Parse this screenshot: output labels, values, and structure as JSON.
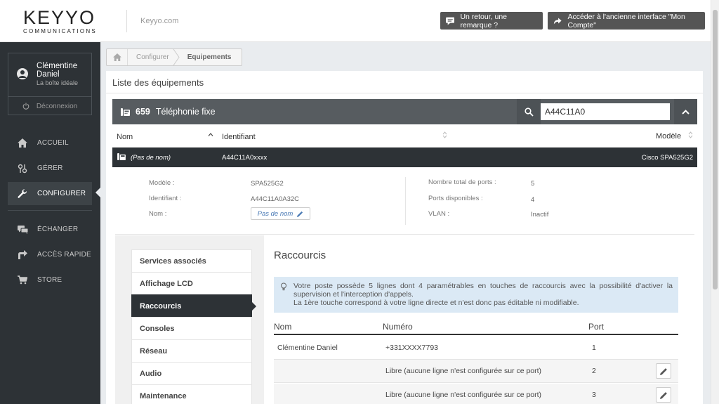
{
  "header": {
    "logo_word": "KEYYO",
    "logo_sub": "COMMUNICATIONS",
    "site_link": "Keyyo.com",
    "feedback_button": "Un retour, une remarque ?",
    "old_interface_button": "Accéder à l'ancienne interface \"Mon Compte\""
  },
  "user": {
    "name": "Clémentine Daniel",
    "company": "La boîte idéale",
    "logout": "Déconnexion"
  },
  "nav": {
    "home": "ACCUEIL",
    "manage": "GÉRER",
    "configure": "CONFIGURER",
    "exchange": "ÉCHANGER",
    "quick_access": "ACCÈS RAPIDE",
    "store": "STORE"
  },
  "breadcrumb": {
    "configure": "Configurer",
    "equipment": "Equipements"
  },
  "panel": {
    "title": "Liste des équipements",
    "count": "659",
    "category": "Téléphonie fixe",
    "search_value": "A44C11A0"
  },
  "columns": {
    "name": "Nom",
    "identifier": "Identifiant",
    "model": "Modèle"
  },
  "selected_row": {
    "name": "(Pas de nom)",
    "identifier": "A44C11A0xxxx",
    "model": "Cisco SPA525G2"
  },
  "details": {
    "model_label": "Modèle :",
    "model_value": "SPA525G2",
    "identifier_label": "Identifiant :",
    "identifier_value": "A44C11A0A32C",
    "name_label": "Nom :",
    "name_value": "Pas de nom",
    "total_ports_label": "Nombre total de ports :",
    "total_ports_value": "5",
    "available_ports_label": "Ports disponibles :",
    "available_ports_value": "4",
    "vlan_label": "VLAN :",
    "vlan_value": "Inactif"
  },
  "subnav": {
    "items": [
      {
        "label": "Services associés"
      },
      {
        "label": "Affichage LCD"
      },
      {
        "label": "Raccourcis"
      },
      {
        "label": "Consoles"
      },
      {
        "label": "Réseau"
      },
      {
        "label": "Audio"
      },
      {
        "label": "Maintenance"
      }
    ],
    "active_index": 2
  },
  "shortcuts": {
    "title": "Raccourcis",
    "info_line1": "Votre poste possède 5 lignes dont 4 paramétrables en touches de raccourcis avec la possibilité d'activer la supervision et l'interception d'appels.",
    "info_line2": "La 1ère touche correspond à votre ligne directe et n'est donc pas éditable ni modifiable.",
    "col_name": "Nom",
    "col_number": "Numéro",
    "col_port": "Port",
    "rows": [
      {
        "name": "Clémentine Daniel",
        "number": "+331XXXX7793",
        "port": "1"
      },
      {
        "name": "",
        "number": "Libre (aucune ligne n'est configurée sur ce port)",
        "port": "2"
      },
      {
        "name": "",
        "number": "Libre (aucune ligne n'est configurée sur ce port)",
        "port": "3"
      }
    ]
  }
}
